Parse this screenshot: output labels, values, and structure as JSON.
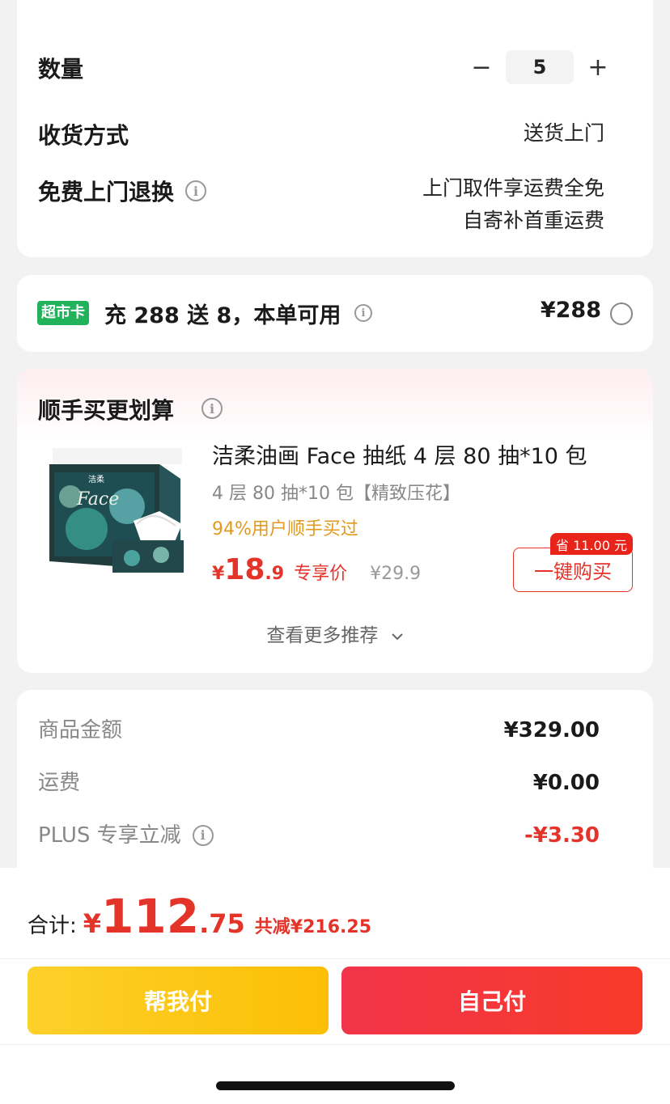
{
  "order": {
    "quantity_label": "数量",
    "minus": "−",
    "quantity": "5",
    "plus": "+",
    "delivery_label": "收货方式",
    "delivery_value": "送货上门",
    "return_label": "免费上门退换",
    "return_value_line1": "上门取件享运费全免",
    "return_value_line2": "自寄补首重运费",
    "info_glyph": "i"
  },
  "promo": {
    "tag": "超市卡",
    "text": "充 288 送 8，本单可用",
    "price": "¥288"
  },
  "recommend": {
    "title": "顺手买更划算",
    "product_name": "洁柔油画 Face 抽纸 4 层 80 抽*10 包",
    "product_spec": "4 层 80 抽*10 包【精致压花】",
    "social_proof": "94%用户顺手买过",
    "price_currency": "¥",
    "price_int": "18",
    "price_dec": ".9",
    "price_tag": "专享价",
    "original_price": "¥29.9",
    "save_badge": "省 11.00 元",
    "buy_button": "一键购买",
    "more": "查看更多推荐",
    "image_brand": "洁柔",
    "image_face": "Face"
  },
  "summary": {
    "rows": [
      {
        "label": "商品金额",
        "value": "¥329.00"
      },
      {
        "label": "运费",
        "value": "¥0.00"
      },
      {
        "label": "PLUS 专享立减",
        "value": "-¥3.30"
      }
    ]
  },
  "footer": {
    "total_label": "合计:",
    "currency": "¥",
    "total_int": "112",
    "total_dec": ".75",
    "saved": "共减¥216.25",
    "help_pay": "帮我付",
    "self_pay": "自己付"
  },
  "colors": {
    "accent_red": "#e4342a",
    "promo_green": "#21b25b",
    "social_orange": "#e09a1e",
    "help_yellow": "#fcc60f",
    "self_red": "#f4363a"
  }
}
